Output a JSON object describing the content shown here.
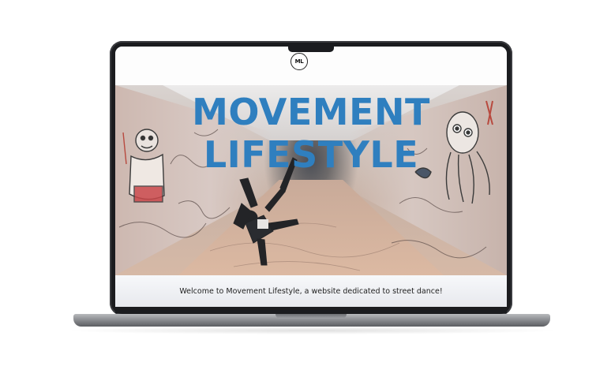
{
  "site": {
    "logo_text": "ML",
    "hero_title_line1": "MOVEMENT",
    "hero_title_line2": "LIFESTYLE",
    "welcome_text": "Welcome to Movement Lifestyle, a website dedicated to street dance!"
  },
  "colors": {
    "title_blue": "#2f7fbf",
    "laptop_bezel": "#1b1c1f",
    "laptop_body": "#8d8f93"
  },
  "icons": [
    "logo-badge"
  ]
}
